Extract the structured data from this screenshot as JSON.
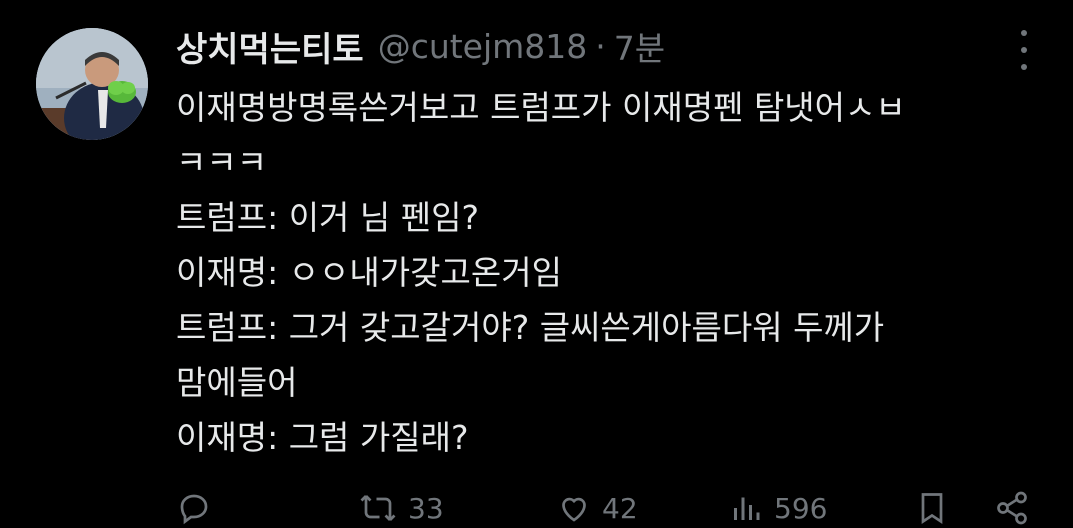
{
  "tweet": {
    "display_name": "상치먹는티토",
    "handle": "@cutejm818",
    "separator": "·",
    "time": "7분",
    "lines": [
      "이재명방명록쓴거보고 트럼프가 이재명펜 탐냇어ㅅㅂ",
      "ㅋㅋㅋ",
      "트럼프: 이거 님 펜임?",
      "이재명: ㅇㅇ내가갖고온거임",
      "트럼프: 그거 갖고갈거야? 글씨쓴게아름다워 두께가",
      "맘에들어",
      "이재명: 그럼 가질래?"
    ]
  },
  "actions": {
    "reply": {
      "icon": "reply-icon",
      "count": ""
    },
    "retweet": {
      "icon": "retweet-icon",
      "count": "33"
    },
    "like": {
      "icon": "heart-icon",
      "count": "42"
    },
    "views": {
      "icon": "views-icon",
      "count": "596"
    },
    "bookmark": {
      "icon": "bookmark-icon",
      "count": ""
    },
    "share": {
      "icon": "share-icon",
      "count": ""
    }
  },
  "colors": {
    "background": "#000000",
    "text": "#e7e9ea",
    "secondary": "#71767b"
  }
}
